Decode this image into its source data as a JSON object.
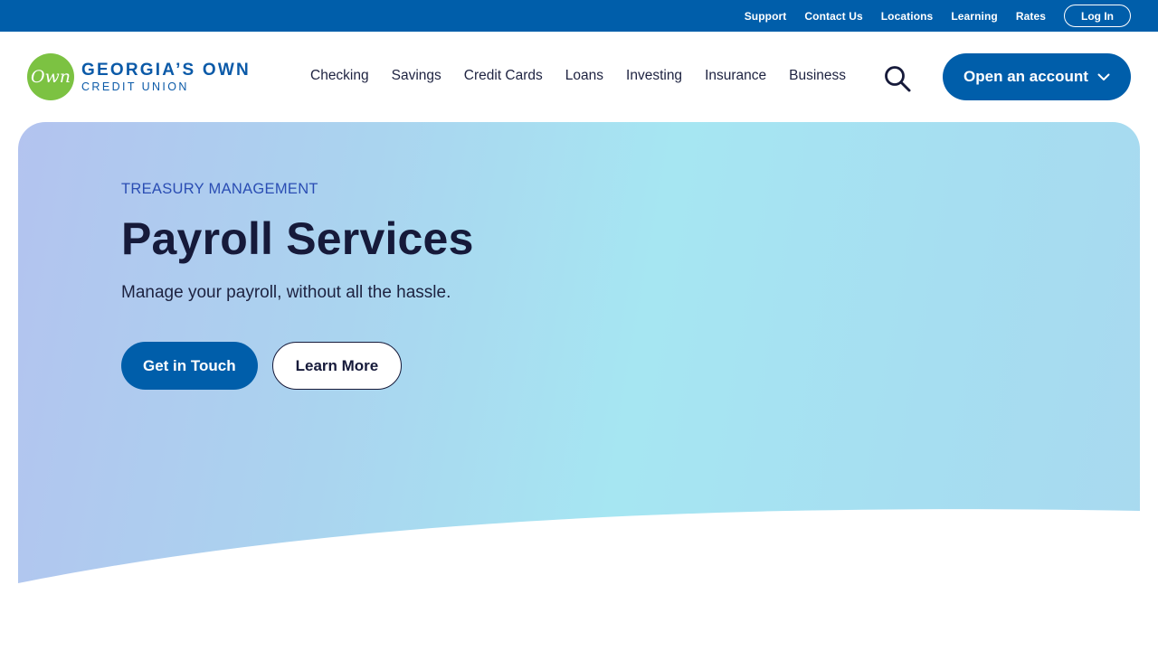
{
  "utility_nav": {
    "links": [
      "Support",
      "Contact Us",
      "Locations",
      "Learning",
      "Rates"
    ],
    "login_label": "Log In"
  },
  "logo": {
    "mark_text": "Own",
    "line1": "GEORGIA’S OWN",
    "line2": "CREDIT UNION"
  },
  "main_nav": {
    "items": [
      "Checking",
      "Savings",
      "Credit Cards",
      "Loans",
      "Investing",
      "Insurance",
      "Business"
    ],
    "search_icon": "search-icon",
    "cta_label": "Open an account",
    "cta_icon": "chevron-down-icon"
  },
  "hero": {
    "eyebrow": "TREASURY MANAGEMENT",
    "title": "Payroll Services",
    "subtitle": "Manage your payroll, without all the hassle.",
    "primary_button": "Get in Touch",
    "secondary_button": "Learn More"
  },
  "colors": {
    "brand_blue": "#005eaa",
    "logo_green": "#7cc242",
    "text_dark": "#161a3a"
  }
}
